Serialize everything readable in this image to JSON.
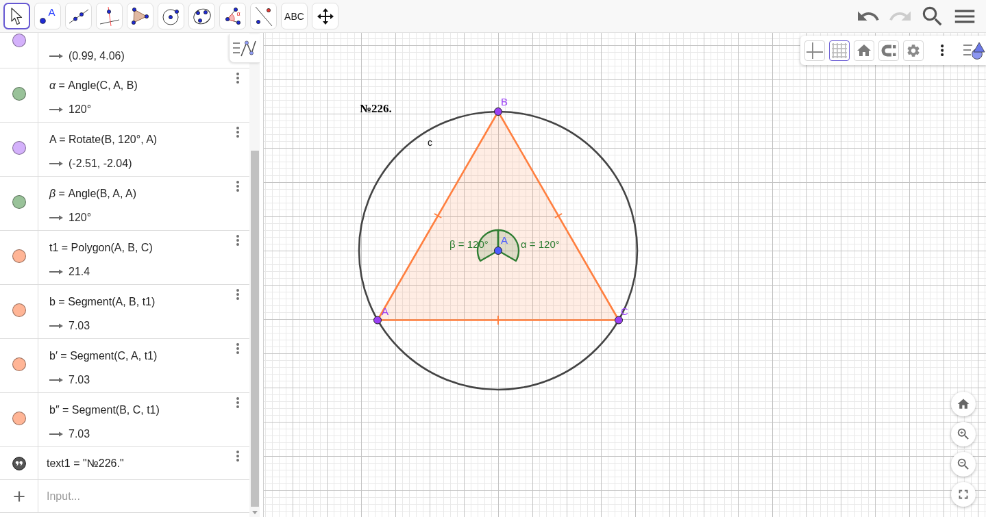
{
  "toolbar": {
    "tools": [
      {
        "kind": "move",
        "selected": true
      },
      {
        "kind": "point",
        "label": "A",
        "selected": false
      },
      {
        "kind": "line",
        "selected": false
      },
      {
        "kind": "perpendicular",
        "selected": false
      },
      {
        "kind": "polygon",
        "selected": false
      },
      {
        "kind": "circle",
        "selected": false
      },
      {
        "kind": "circle_three_points",
        "selected": false
      },
      {
        "kind": "angle",
        "label": "α",
        "selected": false
      },
      {
        "kind": "reflect",
        "selected": false
      },
      {
        "kind": "text",
        "label": "ABC",
        "selected": false
      },
      {
        "kind": "move_view",
        "selected": false
      }
    ],
    "history": [
      {
        "kind": "undo",
        "disabled": false
      },
      {
        "kind": "redo",
        "disabled": true
      }
    ]
  },
  "algebra": {
    "rows": [
      {
        "kind": "point",
        "color": "#d4b1fb",
        "value": "(0.99, 4.06)"
      },
      {
        "kind": "angle",
        "color": "#99c299",
        "definition": "*α* = Angle(C, A, B)",
        "value": "120°"
      },
      {
        "kind": "point",
        "color": "#d4b1fb",
        "definition": "A = Rotate(B, 120°, A)",
        "value": "(-2.51, -2.04)"
      },
      {
        "kind": "angle",
        "color": "#99c299",
        "definition": "*β* = Angle(B, A, A)",
        "value": "120°"
      },
      {
        "kind": "polygon",
        "color": "#ffb596",
        "definition": "t1 = Polygon(A, B, C)",
        "value": "21.4"
      },
      {
        "kind": "segment",
        "color": "#ffb596",
        "definition": "b = Segment(A, B, t1)",
        "value": "7.03"
      },
      {
        "kind": "segment",
        "color": "#ffb596",
        "definition": "b′ = Segment(C, A, t1)",
        "value": "7.03"
      },
      {
        "kind": "segment",
        "color": "#ffb596",
        "definition": "b″ = Segment(B, C, t1)",
        "value": "7.03"
      },
      {
        "kind": "text",
        "definition": "text1 = \"№226.\""
      }
    ],
    "input": {
      "placeholder": "Input..."
    }
  },
  "graphics": {
    "style_bar": {
      "toggles": [
        {
          "kind": "axes",
          "selected": false
        },
        {
          "kind": "grid",
          "selected": true
        }
      ]
    },
    "heading": "№226.",
    "circle": {
      "label": "c"
    },
    "points": [
      {
        "label": "B",
        "color": "#9b40f5"
      },
      {
        "label": "A",
        "color": "#9b40f5"
      },
      {
        "label": "C",
        "color": "#9b40f5"
      },
      {
        "label": "A",
        "color": "#4d5cff"
      }
    ],
    "angles": [
      {
        "label": "β = 120°"
      },
      {
        "label": "α = 120°"
      }
    ]
  }
}
